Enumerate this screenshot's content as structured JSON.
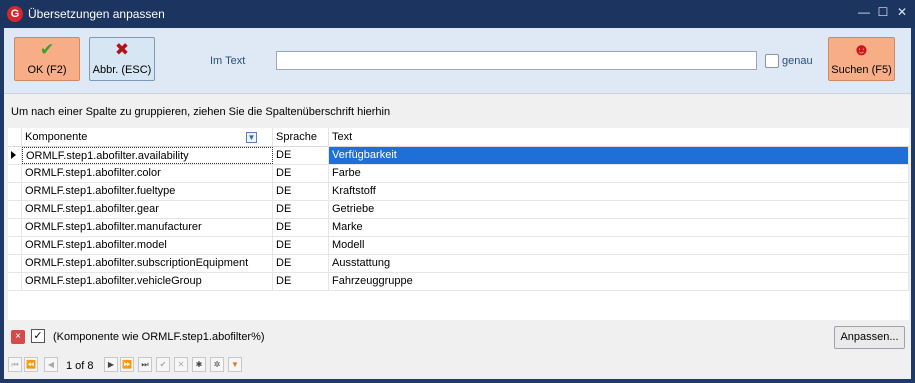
{
  "window": {
    "title": "Übersetzungen anpassen",
    "app_icon_glyph": "G",
    "controls": {
      "minimize": "—",
      "maximize": "☐",
      "close": "✕"
    }
  },
  "toolbar": {
    "ok": {
      "label": "OK (F2)",
      "icon": "checkmark-icon",
      "glyph": "✔"
    },
    "cancel": {
      "label": "Abbr. (ESC)",
      "icon": "cross-icon",
      "glyph": "✖"
    },
    "search_label": "Im Text",
    "search_value": "",
    "genau_label": "genau",
    "genau_checked": false,
    "search_button": {
      "label": "Suchen (F5)",
      "icon": "person-search-icon",
      "glyph": "☻"
    }
  },
  "group_hint": "Um nach einer Spalte zu gruppieren, ziehen Sie die Spaltenüberschrift hierhin",
  "grid": {
    "columns": [
      "Komponente",
      "Sprache",
      "Text"
    ],
    "rows": [
      {
        "komponente": "ORMLF.step1.abofilter.availability",
        "sprache": "DE",
        "text": "Verfügbarkeit"
      },
      {
        "komponente": "ORMLF.step1.abofilter.color",
        "sprache": "DE",
        "text": "Farbe"
      },
      {
        "komponente": "ORMLF.step1.abofilter.fueltype",
        "sprache": "DE",
        "text": "Kraftstoff"
      },
      {
        "komponente": "ORMLF.step1.abofilter.gear",
        "sprache": "DE",
        "text": "Getriebe"
      },
      {
        "komponente": "ORMLF.step1.abofilter.manufacturer",
        "sprache": "DE",
        "text": "Marke"
      },
      {
        "komponente": "ORMLF.step1.abofilter.model",
        "sprache": "DE",
        "text": "Modell"
      },
      {
        "komponente": "ORMLF.step1.abofilter.subscriptionEquipment",
        "sprache": "DE",
        "text": "Ausstattung"
      },
      {
        "komponente": "ORMLF.step1.abofilter.vehicleGroup",
        "sprache": "DE",
        "text": "Fahrzeuggruppe"
      }
    ]
  },
  "filter": {
    "close_glyph": "×",
    "check_glyph": "✓",
    "enabled": true,
    "text": "(Komponente wie ORMLF.step1.abofilter%)",
    "customize_label": "Anpassen..."
  },
  "navigator": {
    "page_info": "1 of 8",
    "buttons": [
      {
        "name": "first-page-button",
        "glyph": "⏮",
        "disabled": true
      },
      {
        "name": "prev-page-button",
        "glyph": "⏪",
        "disabled": true
      },
      {
        "name": "prev-record-button",
        "glyph": "◀",
        "disabled": true
      },
      {
        "name": "next-record-button",
        "glyph": "▶",
        "disabled": false
      },
      {
        "name": "next-page-button",
        "glyph": "⏩",
        "disabled": false
      },
      {
        "name": "last-page-button",
        "glyph": "⏭",
        "disabled": false
      },
      {
        "name": "apply-button",
        "glyph": "✔",
        "disabled": true
      },
      {
        "name": "cancel-edit-button",
        "glyph": "✕",
        "disabled": true
      },
      {
        "name": "asterisk-button",
        "glyph": "✱",
        "disabled": false
      },
      {
        "name": "asterisk-alt-button",
        "glyph": "✲",
        "disabled": false
      },
      {
        "name": "filter-button",
        "glyph": "▼",
        "disabled": false
      }
    ]
  },
  "colors": {
    "accent": "#f7ae86",
    "selection": "#1e6fd6",
    "title_bar": "#1b3560"
  }
}
